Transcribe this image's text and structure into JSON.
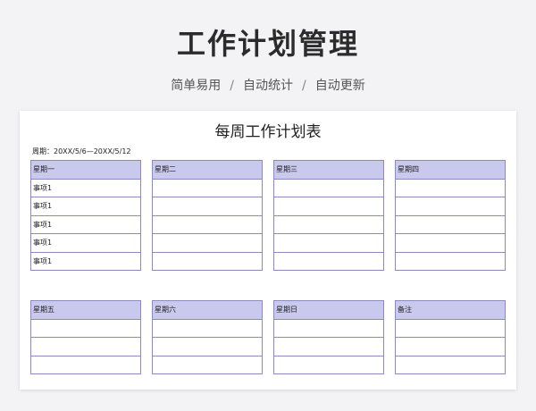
{
  "banner": {
    "title": "工作计划管理",
    "features": [
      "简单易用",
      "自动统计",
      "自动更新"
    ],
    "separator": "/"
  },
  "sheet": {
    "title": "每周工作计划表",
    "period": "周期：20XX/5/6—20XX/5/12",
    "row1": [
      {
        "header": "星期一",
        "items": [
          "事项1",
          "事项1",
          "事项1",
          "事项1",
          "事项1"
        ]
      },
      {
        "header": "星期二",
        "items": [
          "",
          "",
          "",
          "",
          ""
        ]
      },
      {
        "header": "星期三",
        "items": [
          "",
          "",
          "",
          "",
          ""
        ]
      },
      {
        "header": "星期四",
        "items": [
          "",
          "",
          "",
          "",
          ""
        ]
      }
    ],
    "row2": [
      {
        "header": "星期五",
        "items": [
          "",
          "",
          ""
        ]
      },
      {
        "header": "星期六",
        "items": [
          "",
          "",
          ""
        ]
      },
      {
        "header": "星期日",
        "items": [
          "",
          "",
          ""
        ]
      },
      {
        "header": "备注",
        "items": [
          "",
          "",
          ""
        ]
      }
    ]
  },
  "colors": {
    "header_fill": "#c8c9ec",
    "grid_line": "#8a8ac0"
  }
}
